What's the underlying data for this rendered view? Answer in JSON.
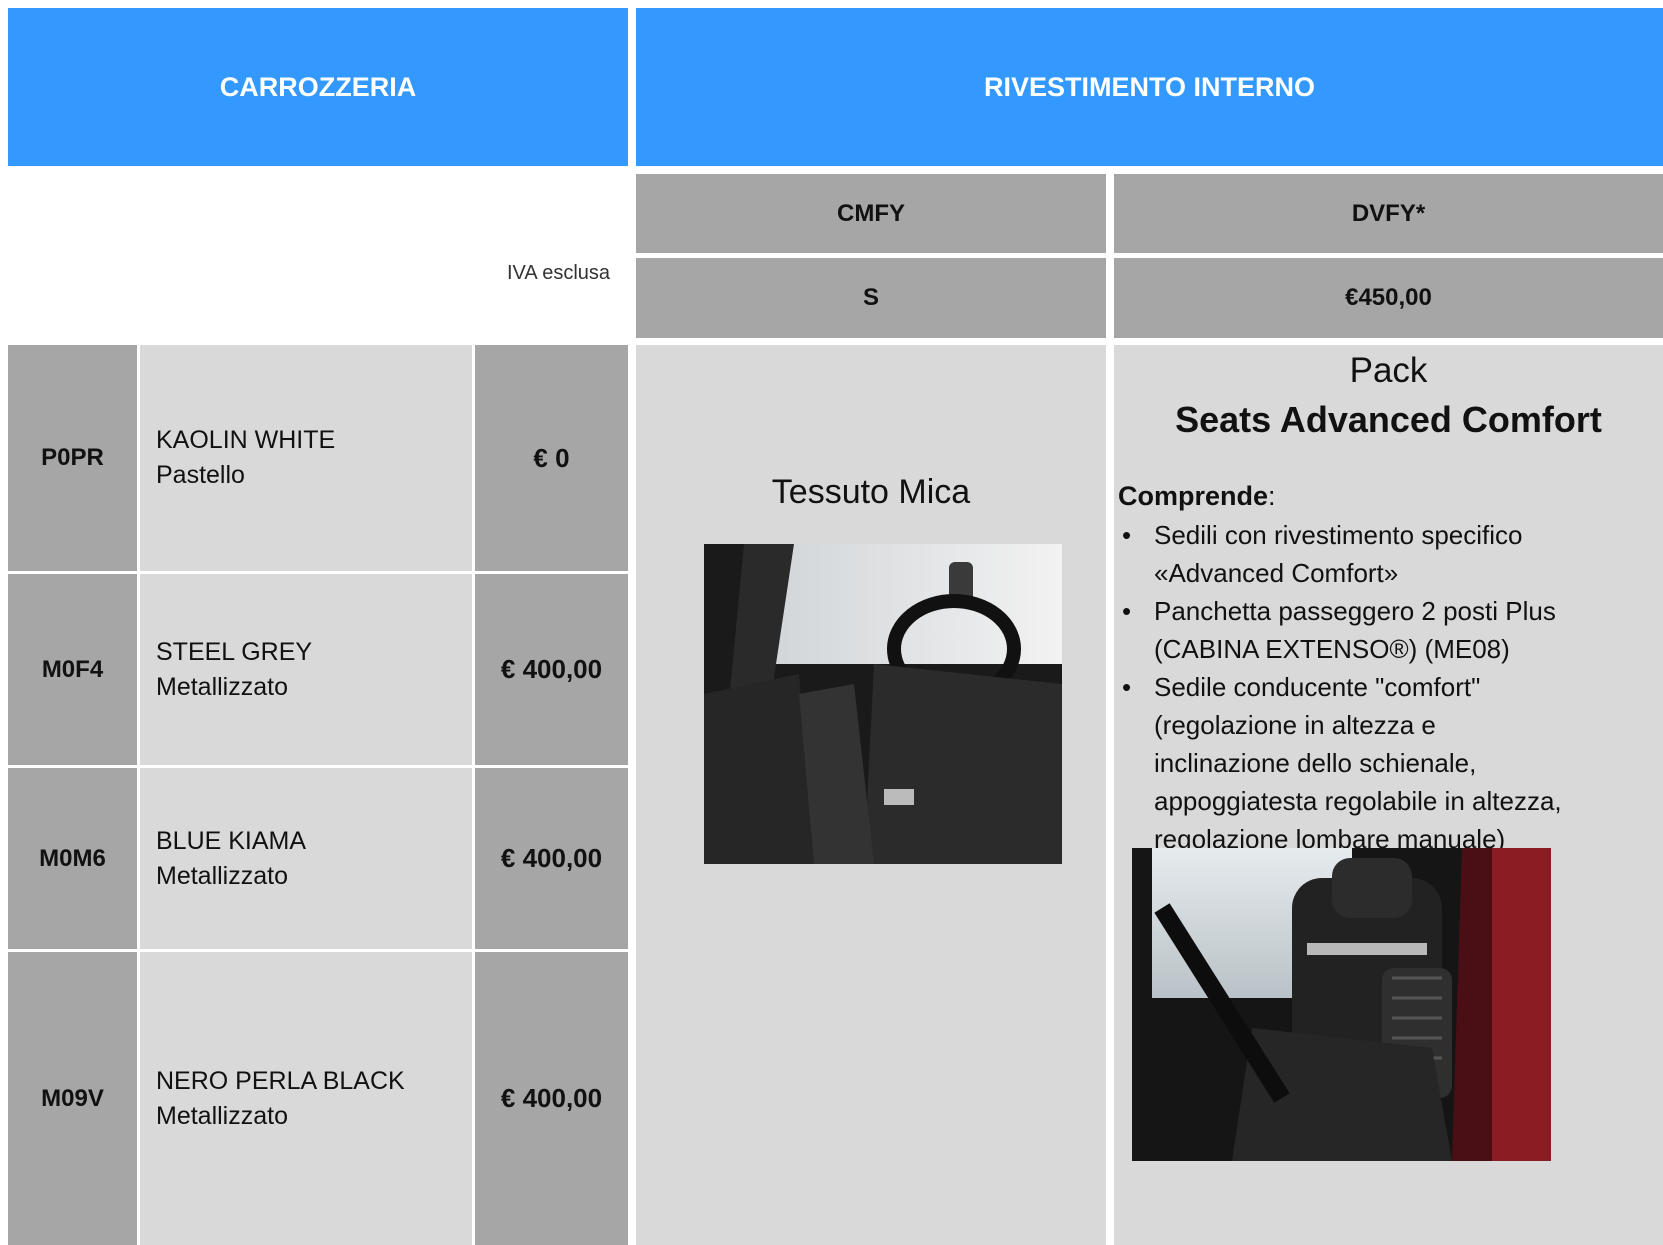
{
  "headers": {
    "carrozzeria": "CARROZZERIA",
    "rivestimento": "RIVESTIMENTO INTERNO"
  },
  "iva_note": "IVA esclusa",
  "interior_columns": [
    {
      "code": "CMFY",
      "price": "S"
    },
    {
      "code": "DVFY*",
      "price": "€450,00"
    }
  ],
  "colors": [
    {
      "code": "P0PR",
      "name": "KAOLIN WHITE",
      "finish": "Pastello",
      "price": "€ 0"
    },
    {
      "code": "M0F4",
      "name": "STEEL GREY",
      "finish": "Metallizzato",
      "price": "€ 400,00"
    },
    {
      "code": "M0M6",
      "name": "BLUE KIAMA",
      "finish": "Metallizzato",
      "price": "€ 400,00"
    },
    {
      "code": "M09V",
      "name": "NERO PERLA BLACK",
      "finish": "Metallizzato",
      "price": "€ 400,00"
    }
  ],
  "mica": {
    "title": "Tessuto Mica",
    "image": "seat-fabric-photo"
  },
  "pack": {
    "line1": "Pack",
    "line2": "Seats Advanced Comfort",
    "comprende_label": "Comprende",
    "comprende_colon": ":",
    "items": [
      "Sedili con rivestimento specifico «Advanced Comfort»",
      "Panchetta passeggero 2 posti Plus (CABINA EXTENSO®) (ME08)",
      "Sedile conducente \"comfort\" (regolazione in altezza e inclinazione dello schienale, appoggiatesta regolabile in altezza, regolazione lombare manuale)"
    ],
    "image": "advanced-comfort-seat-photo"
  },
  "palette": {
    "header_blue": "#3399ff",
    "dark_gray": "#a6a6a6",
    "light_gray": "#d9d9d9"
  }
}
